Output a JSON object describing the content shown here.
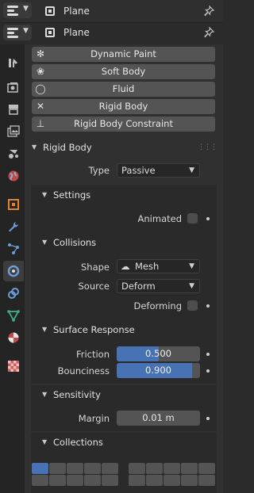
{
  "header": {
    "object_name": "Plane",
    "editor_icon": "properties-editor-icon",
    "pin_icon": "pin-icon"
  },
  "physics_buttons": [
    {
      "label": "Dynamic Paint",
      "icon": "dynamic-paint-icon"
    },
    {
      "label": "Soft Body",
      "icon": "soft-body-icon"
    },
    {
      "label": "Fluid",
      "icon": "fluid-icon"
    },
    {
      "label": "Rigid Body",
      "icon": "close-icon"
    },
    {
      "label": "Rigid Body Constraint",
      "icon": "rigid-body-constraint-icon"
    }
  ],
  "rigid_body": {
    "title": "Rigid Body",
    "type_label": "Type",
    "type_value": "Passive",
    "settings": {
      "title": "Settings",
      "animated_label": "Animated",
      "animated": false
    },
    "collisions": {
      "title": "Collisions",
      "shape_label": "Shape",
      "shape_value": "Mesh",
      "source_label": "Source",
      "source_value": "Deform",
      "deforming_label": "Deforming",
      "deforming": false
    },
    "surface_response": {
      "title": "Surface Response",
      "friction_label": "Friction",
      "friction_value": "0.500",
      "friction": 0.5,
      "bounciness_label": "Bounciness",
      "bounciness_value": "0.900",
      "bounciness": 0.9
    },
    "sensitivity": {
      "title": "Sensitivity",
      "margin_label": "Margin",
      "margin_value": "0.01 m"
    },
    "collections": {
      "title": "Collections",
      "active_index": 0
    }
  },
  "colors": {
    "accent": "#4772b3",
    "panel": "#303030",
    "sidebar": "#242424"
  }
}
